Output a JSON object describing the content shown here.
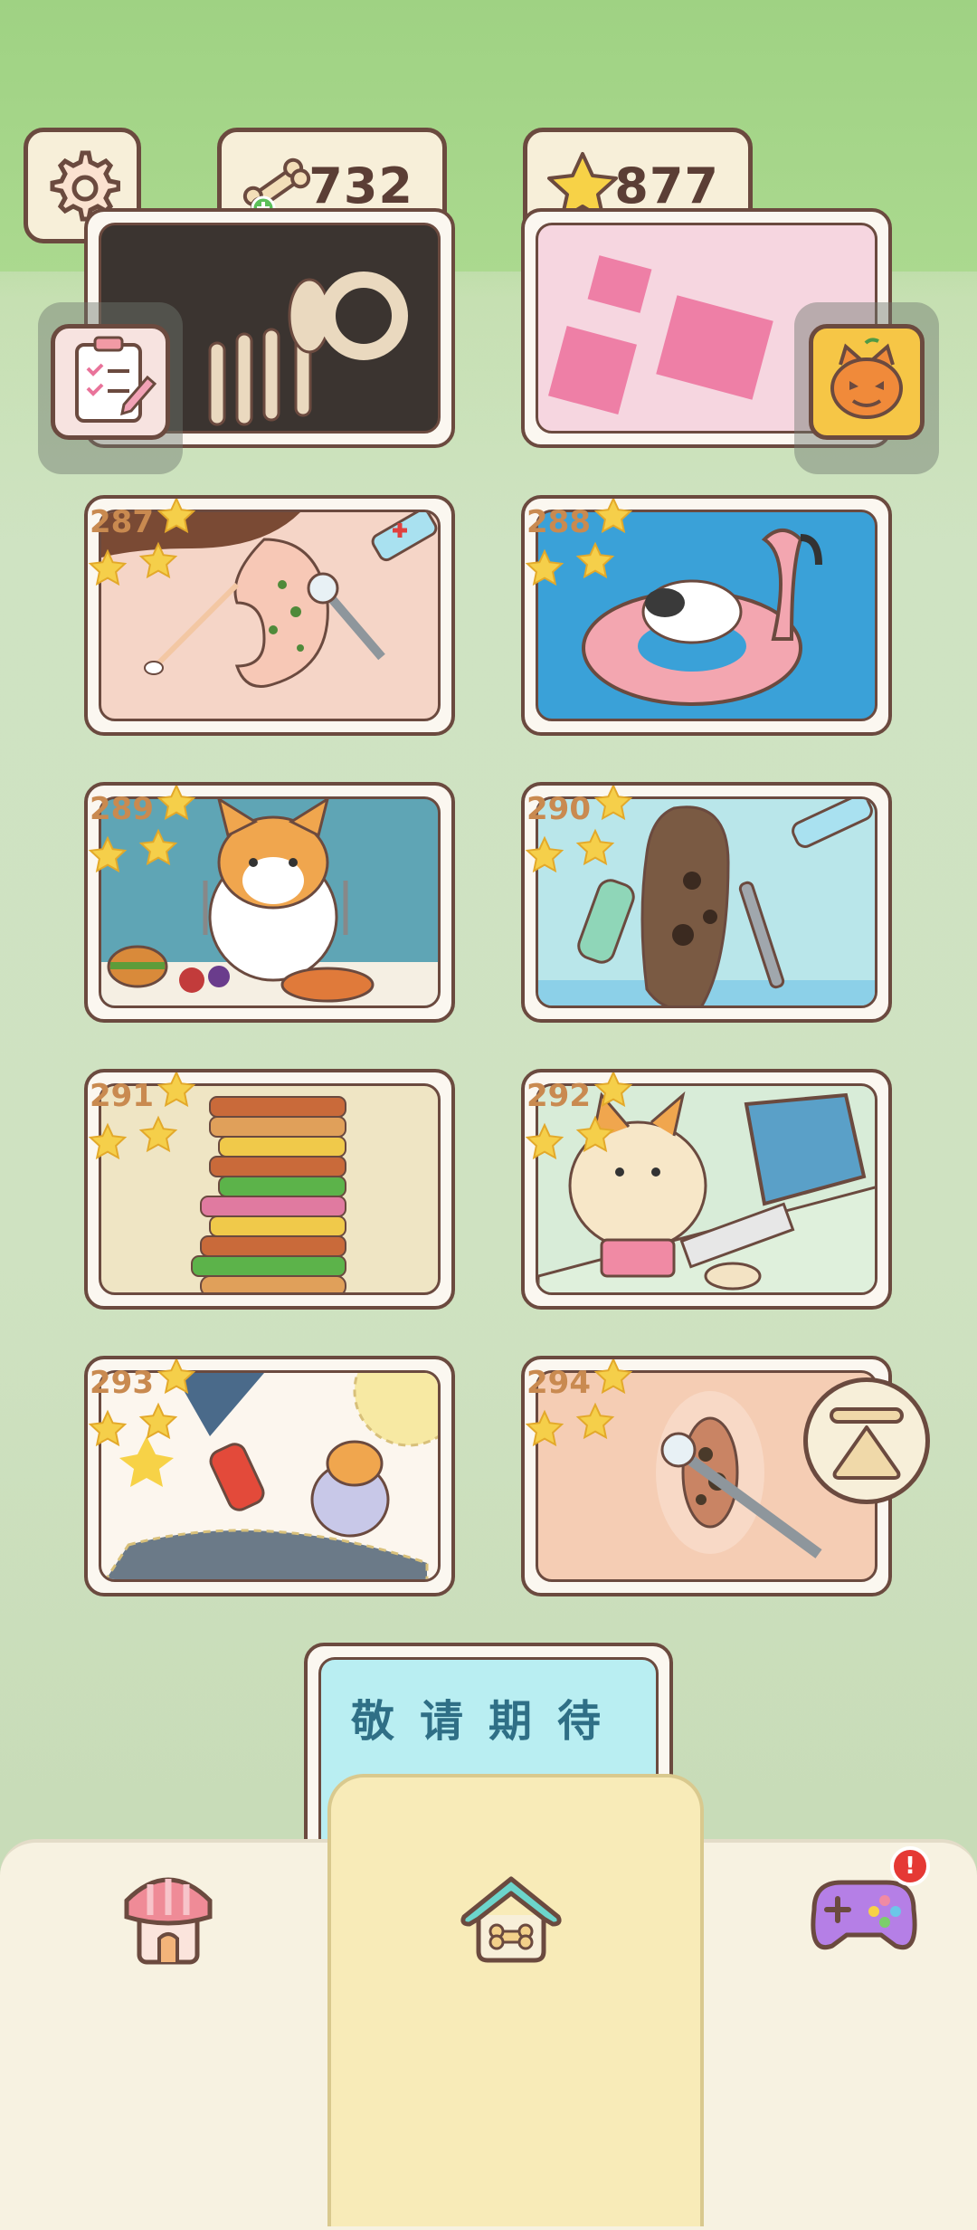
{
  "header": {
    "bones_count": "732",
    "stars_count": "877",
    "icons": {
      "settings": "gear-icon",
      "bones": "bone-plus-icon",
      "stars": "star-icon"
    }
  },
  "side_buttons": {
    "left": "task-clipboard-icon",
    "right": "pumpkin-cat-icon"
  },
  "levels": [
    {
      "number": "287",
      "stars": 3,
      "scene": "ear-cleaning"
    },
    {
      "number": "288",
      "stars": 3,
      "scene": "cat-on-flamingo-float"
    },
    {
      "number": "289",
      "stars": 3,
      "scene": "corgi-feast"
    },
    {
      "number": "290",
      "stars": 3,
      "scene": "foot-care"
    },
    {
      "number": "291",
      "stars": 3,
      "scene": "burger-tower"
    },
    {
      "number": "292",
      "stars": 3,
      "scene": "cat-at-computer"
    },
    {
      "number": "293",
      "stars": 3,
      "scene": "sticker-sheet"
    },
    {
      "number": "294",
      "stars": 3,
      "scene": "navel-cleaning"
    }
  ],
  "coming_soon": {
    "text": "敬请期待"
  },
  "bottom_nav": {
    "items": [
      {
        "name": "shop",
        "icon": "shop-awning-icon"
      },
      {
        "name": "home",
        "icon": "dog-house-icon",
        "active": true
      },
      {
        "name": "games",
        "icon": "gamepad-icon",
        "badge": "!"
      }
    ]
  },
  "colors": {
    "outline": "#6b4a3f",
    "level_number": "#c98a50",
    "star": "#f5cf4a"
  }
}
